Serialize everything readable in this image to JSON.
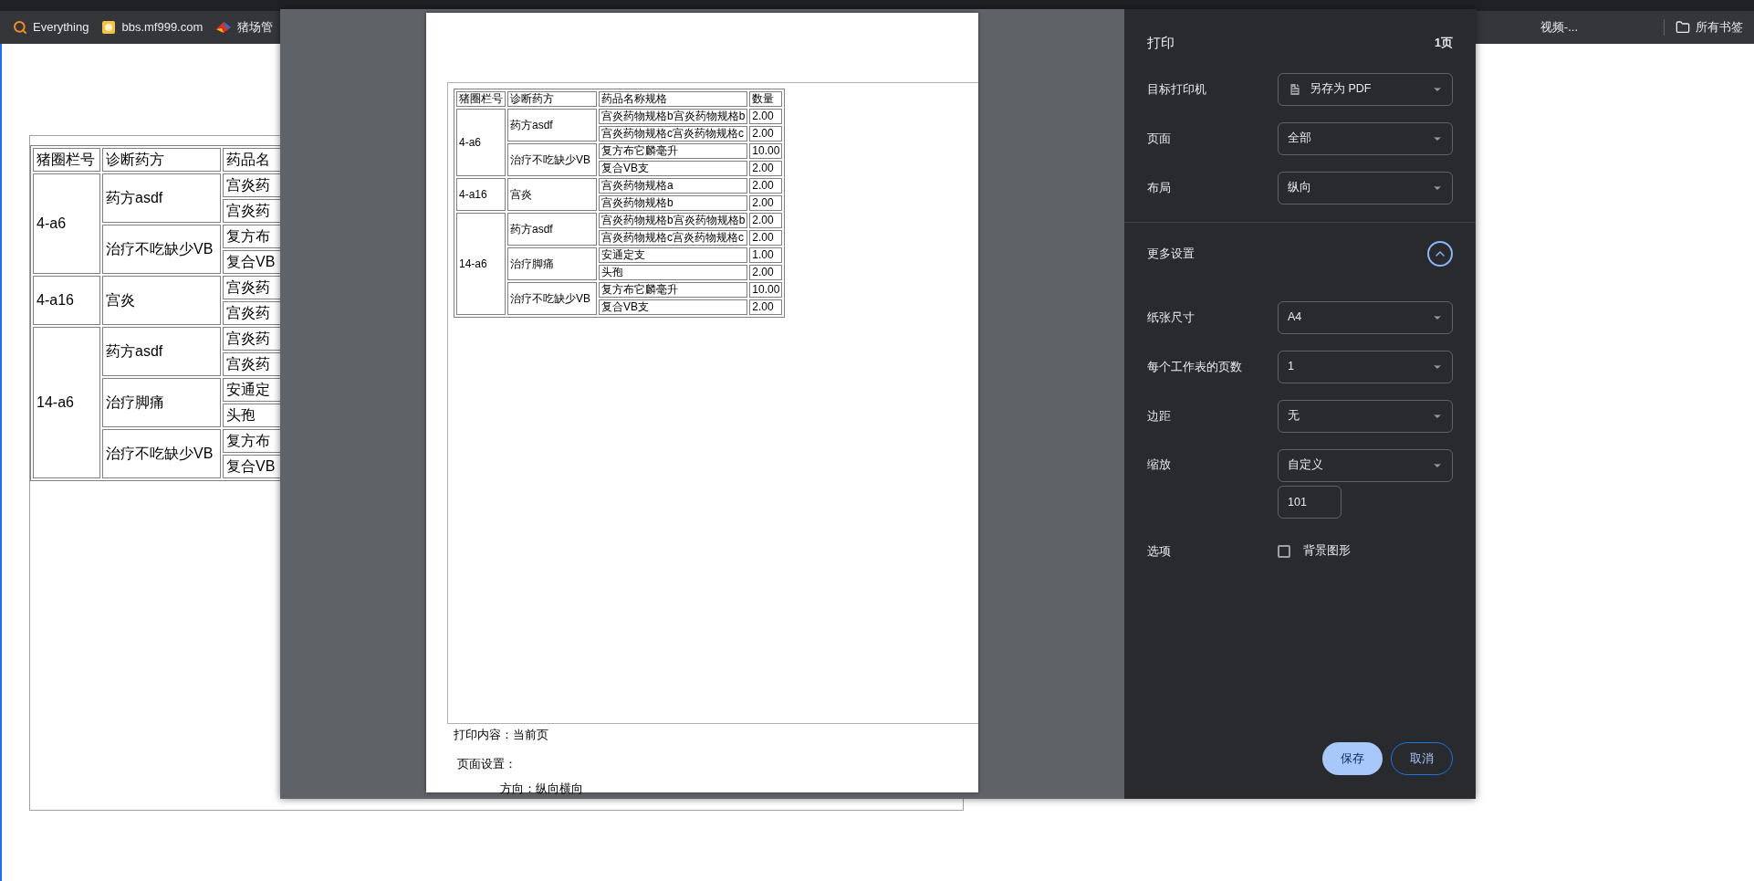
{
  "bookmarks": [
    {
      "label": "Everything",
      "kind": "search"
    },
    {
      "label": "bbs.mf999.com",
      "kind": "site"
    },
    {
      "label": "猪场管",
      "kind": "app"
    }
  ],
  "bookmarks_right": {
    "partial": "视频-...",
    "all_bookmarks": "所有书签"
  },
  "background_table": {
    "columns": [
      "猪圈栏号",
      "诊断药方",
      "药品名"
    ],
    "groups": [
      {
        "pen": "4-a6",
        "prescriptions": [
          {
            "name": "药方asdf",
            "items": [
              "宫炎药",
              "宫炎药"
            ]
          },
          {
            "name": "治疗不吃缺少VB",
            "items": [
              "复方布",
              "复合VB"
            ]
          }
        ]
      },
      {
        "pen": "4-a16",
        "prescriptions": [
          {
            "name": "宫炎",
            "items": [
              "宫炎药",
              "宫炎药"
            ]
          }
        ]
      },
      {
        "pen": "14-a6",
        "prescriptions": [
          {
            "name": "药方asdf",
            "items": [
              "宫炎药",
              "宫炎药"
            ]
          },
          {
            "name": "治疗脚痛",
            "items": [
              "安通定",
              "头孢"
            ]
          },
          {
            "name": "治疗不吃缺少VB",
            "items": [
              "复方布",
              "复合VB"
            ]
          }
        ]
      }
    ]
  },
  "preview": {
    "columns": [
      "猪圈栏号",
      "诊断药方",
      "药品名称规格",
      "数量"
    ],
    "groups": [
      {
        "pen": "4-a6",
        "prescriptions": [
          {
            "name": "药方asdf",
            "items": [
              {
                "drug": "宫炎药物规格b宫炎药物规格b",
                "qty": "2.00"
              },
              {
                "drug": "宫炎药物规格c宫炎药物规格c",
                "qty": "2.00"
              }
            ]
          },
          {
            "name": "治疗不吃缺少VB",
            "items": [
              {
                "drug": "复方布它麟毫升",
                "qty": "10.00"
              },
              {
                "drug": "复合VB支",
                "qty": "2.00"
              }
            ]
          }
        ]
      },
      {
        "pen": "4-a16",
        "prescriptions": [
          {
            "name": "宫炎",
            "items": [
              {
                "drug": "宫炎药物规格a",
                "qty": "2.00"
              },
              {
                "drug": "宫炎药物规格b",
                "qty": "2.00"
              }
            ]
          }
        ]
      },
      {
        "pen": "14-a6",
        "prescriptions": [
          {
            "name": "药方asdf",
            "items": [
              {
                "drug": "宫炎药物规格b宫炎药物规格b",
                "qty": "2.00"
              },
              {
                "drug": "宫炎药物规格c宫炎药物规格c",
                "qty": "2.00"
              }
            ]
          },
          {
            "name": "治疗脚痛",
            "items": [
              {
                "drug": "安通定支",
                "qty": "1.00"
              },
              {
                "drug": "头孢",
                "qty": "2.00"
              }
            ]
          },
          {
            "name": "治疗不吃缺少VB",
            "items": [
              {
                "drug": "复方布它麟毫升",
                "qty": "10.00"
              },
              {
                "drug": "复合VB支",
                "qty": "2.00"
              }
            ]
          }
        ]
      }
    ],
    "footer": [
      "打印内容：当前页",
      "页面设置：",
      "方向：纵向横向"
    ]
  },
  "print_panel": {
    "title": "打印",
    "page_count": "1页",
    "main_settings": [
      {
        "label": "目标打印机",
        "kind": "printer",
        "value": "另存为 PDF"
      },
      {
        "label": "页面",
        "kind": "select",
        "value": "全部"
      },
      {
        "label": "布局",
        "kind": "select",
        "value": "纵向"
      }
    ],
    "more_settings": {
      "label": "更多设置",
      "expanded": true
    },
    "extra_settings": [
      {
        "label": "纸张尺寸",
        "kind": "select",
        "value": "A4"
      },
      {
        "label": "每个工作表的页数",
        "kind": "select",
        "value": "1"
      },
      {
        "label": "边距",
        "kind": "select",
        "value": "无"
      },
      {
        "label": "缩放",
        "kind": "scale",
        "value": "自定义",
        "custom": "101"
      },
      {
        "label": "选项",
        "kind": "checkbox",
        "option": "背景图形",
        "checked": false
      }
    ],
    "buttons": [
      {
        "label": "保存",
        "kind": "primary"
      },
      {
        "label": "取消",
        "kind": "secondary"
      }
    ]
  }
}
